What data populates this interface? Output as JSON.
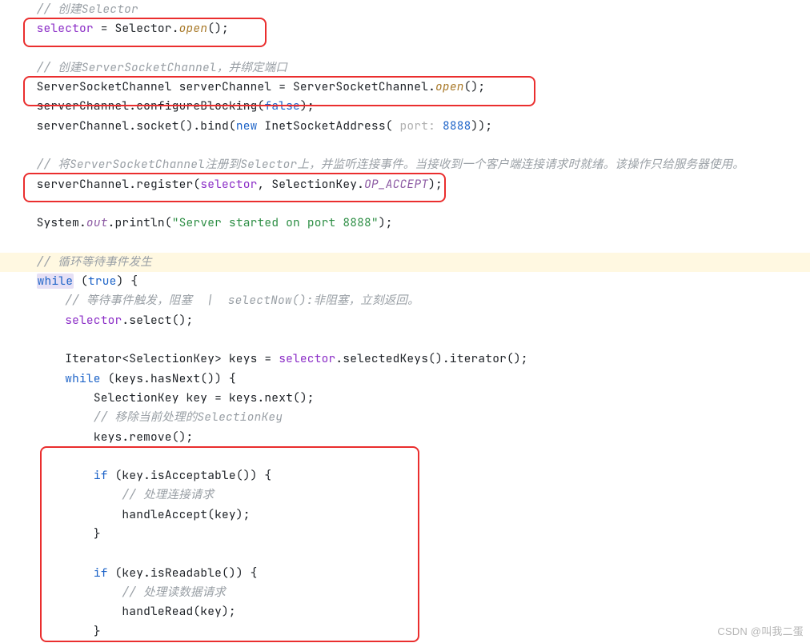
{
  "code": {
    "c1_comment": "// 创建Selector",
    "c2_selector": "selector",
    "c2_assign": " = Selector.",
    "c2_open": "open",
    "c2_tail": "();",
    "c3_comment": "// 创建ServerSocketChannel，并绑定端口",
    "c4_a": "ServerSocketChannel serverChannel = ServerSocketChannel.",
    "c4_open": "open",
    "c4_b": "();",
    "c5_a": "serverChannel.configureBlocking(",
    "c5_false": "false",
    "c5_b": ");",
    "c6_a": "serverChannel.socket().bind(",
    "c6_new": "new",
    "c6_b": " InetSocketAddress(",
    "c6_hint": " port: ",
    "c6_num": "8888",
    "c6_c": "));",
    "c7_comment": "// 将ServerSocketChannel注册到Selector上，并监听连接事件。当接收到一个客户端连接请求时就绪。该操作只给服务器使用。",
    "c8_a": "serverChannel.register(",
    "c8_sel": "selector",
    "c8_b": ", SelectionKey.",
    "c8_op": "OP_ACCEPT",
    "c8_c": ");",
    "c9_a": "System.",
    "c9_out": "out",
    "c9_b": ".println(",
    "c9_str": "\"Server started on port 8888\"",
    "c9_c": ");",
    "c10_comment": "// 循环等待事件发生",
    "c11_while": "while",
    "c11_a": " (",
    "c11_true": "true",
    "c11_b": ") {",
    "c12_comment": "// 等待事件触发，阻塞  |  selectNow():非阻塞，立刻返回。",
    "c13_sel": "selector",
    "c13_a": ".select();",
    "c14_a": "Iterator<SelectionKey> keys = ",
    "c14_sel": "selector",
    "c14_b": ".selectedKeys().iterator();",
    "c15_while": "while",
    "c15_a": " (keys.hasNext()) {",
    "c16_a": "SelectionKey key = keys.next();",
    "c17_comment": "// 移除当前处理的SelectionKey",
    "c18_a": "keys.remove();",
    "c19_if": "if",
    "c19_a": " (key.isAcceptable()) {",
    "c20_comment": "// 处理连接请求",
    "c21_a": "handleAccept(key);",
    "c22_brace": "}",
    "c23_if": "if",
    "c23_a": " (key.isReadable()) {",
    "c24_comment": "// 处理读数据请求",
    "c25_a": "handleRead(key);",
    "c26_brace": "}"
  },
  "watermark": "CSDN @叫我二蛋",
  "highlight_boxes": [
    "selector-open",
    "server-socket-open",
    "register-selector",
    "handle-block"
  ]
}
